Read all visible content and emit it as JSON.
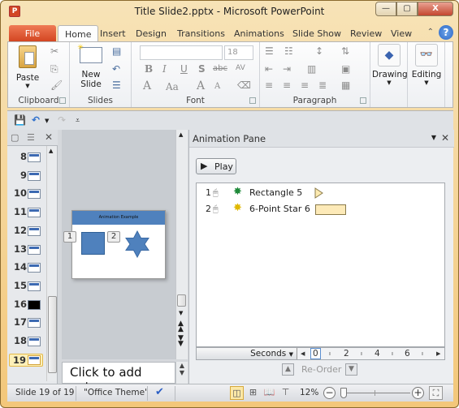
{
  "window": {
    "title": "Title Slide2.pptx  -  Microsoft PowerPoint",
    "app_icon": "P",
    "controls": {
      "minimize": "—",
      "maximize": "▢",
      "close": "X"
    }
  },
  "tabs": [
    {
      "label": "File"
    },
    {
      "label": "Home"
    },
    {
      "label": "Insert"
    },
    {
      "label": "Design"
    },
    {
      "label": "Transitions"
    },
    {
      "label": "Animations"
    },
    {
      "label": "Slide Show"
    },
    {
      "label": "Review"
    },
    {
      "label": "View"
    }
  ],
  "help_label": "?",
  "ribbon": {
    "groups": {
      "clipboard": "Clipboard",
      "slides": "Slides",
      "font": "Font",
      "paragraph": "Paragraph"
    },
    "paste_label": "Paste",
    "new_slide_label_1": "New",
    "new_slide_label_2": "Slide",
    "drawing_label": "Drawing",
    "editing_label": "Editing",
    "font_name": "",
    "font_size": "18",
    "font_buttons": [
      "B",
      "I",
      "U",
      "S",
      "abc",
      "AV"
    ],
    "font_row2": [
      "A",
      "Aa",
      "A",
      "A"
    ]
  },
  "slide_thumbnails": [
    {
      "num": "8"
    },
    {
      "num": "9"
    },
    {
      "num": "10"
    },
    {
      "num": "11"
    },
    {
      "num": "12"
    },
    {
      "num": "13"
    },
    {
      "num": "14"
    },
    {
      "num": "15"
    },
    {
      "num": "16"
    },
    {
      "num": "17"
    },
    {
      "num": "18"
    },
    {
      "num": "19"
    }
  ],
  "slide": {
    "title": "Animation Example",
    "tag1": "1",
    "tag2": "2",
    "colors": {
      "title_bar": "#4f81bd",
      "shape": "#4f81bd"
    }
  },
  "notes_placeholder": "Click to add notes",
  "animation_pane": {
    "title": "Animation Pane",
    "play_label": "Play",
    "items": [
      {
        "order": "1",
        "name": "Rectangle 5",
        "effect": "green-star-entrance"
      },
      {
        "order": "2",
        "name": "6-Point Star 6",
        "effect": "yellow-star-emphasis"
      }
    ],
    "timeline": {
      "unit": "Seconds",
      "ticks": [
        "0",
        "2",
        "4",
        "6"
      ]
    },
    "reorder_label": "Re-Order"
  },
  "status": {
    "slide_info": "Slide 19 of 19",
    "theme": "\"Office Theme\"",
    "zoom": "12%",
    "zoom_fraction": 0.02
  }
}
